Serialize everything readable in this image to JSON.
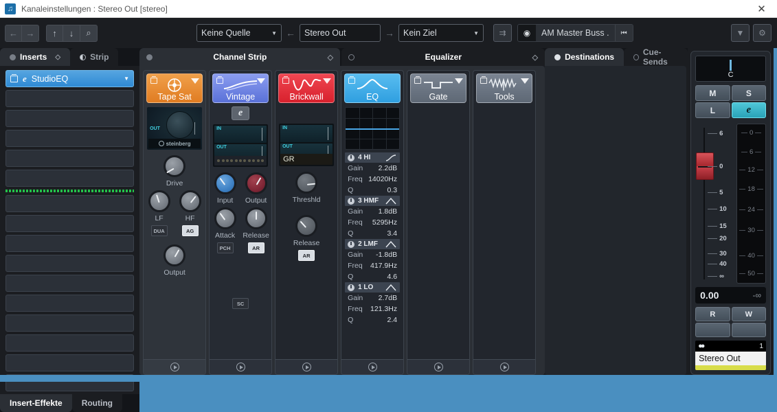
{
  "window": {
    "title": "Kanaleinstellungen : Stereo Out [stereo]",
    "close_label": "✕",
    "app_icon": "cubase-icon"
  },
  "toolbar": {
    "nav_back": "←",
    "nav_forward": "→",
    "up": "↑",
    "down": "↓",
    "search": "⌕",
    "source": {
      "value": "Keine Quelle",
      "arrow": "▼"
    },
    "arrow_left": "←",
    "channel": {
      "value": "Stereo Out"
    },
    "arrow_right": "→",
    "destination": {
      "value": "Kein Ziel",
      "arrow": "▼"
    },
    "bypass_icon": "output-routing-icon",
    "preset": {
      "icon": "preset-icon",
      "name": "AM Master Buss .",
      "prev": "⏮"
    },
    "menu_arrow": "▼",
    "settings_icon": "⚙"
  },
  "inserts": {
    "tabs": [
      {
        "label": "Inserts",
        "active": true,
        "dot": "filled"
      },
      {
        "label": "Strip",
        "active": false,
        "dot": "half"
      }
    ],
    "slots": [
      {
        "name": "StudioEQ",
        "active": true,
        "arrow": "▼",
        "edit": "e"
      },
      {
        "name": "",
        "active": false
      },
      {
        "name": "",
        "active": false
      },
      {
        "name": "",
        "active": false
      },
      {
        "name": "",
        "active": false
      },
      {
        "name": "",
        "active": false
      },
      {
        "name": "",
        "active": false
      },
      {
        "name": "",
        "active": false
      },
      {
        "name": "",
        "active": false
      },
      {
        "name": "",
        "active": false
      },
      {
        "name": "",
        "active": false
      },
      {
        "name": "",
        "active": false
      },
      {
        "name": "",
        "active": false
      },
      {
        "name": "",
        "active": false
      },
      {
        "name": "",
        "active": false
      },
      {
        "name": "",
        "active": false
      }
    ],
    "post_separator_after_slot": 6,
    "bottom_tabs": [
      {
        "label": "Insert-Effekte",
        "active": true
      },
      {
        "label": "Routing",
        "active": false
      }
    ]
  },
  "channel_strip": {
    "tab_label": "Channel Strip",
    "tab_active": true,
    "modules": [
      {
        "name": "Tape Sat",
        "color": "#e8892e",
        "icon": "tape-saturation-icon",
        "display": "tape",
        "display_label": "OUT",
        "brand": "steinberg",
        "knobs": [
          {
            "label": "Drive",
            "style": "grey",
            "angle": -120
          },
          {
            "label": "LF",
            "style": "grey",
            "angle": -18
          },
          {
            "label": "HF",
            "style": "grey",
            "angle": 38
          },
          {
            "label": "Output",
            "style": "grey",
            "angle": 30
          }
        ],
        "buttons": [
          {
            "label": "DUA",
            "on": false
          },
          {
            "label": "AG",
            "on": true
          }
        ],
        "foot_icon": "play-icon"
      },
      {
        "name": "Vintage",
        "color": "#6f84e0",
        "icon": "vintage-compressor-icon",
        "has_edit_button": true,
        "edit_label": "e",
        "display": "meters",
        "meter_labels": [
          "IN",
          "OUT"
        ],
        "knobs": [
          {
            "label": "Input",
            "style": "blue",
            "angle": -36
          },
          {
            "label": "Output",
            "style": "red",
            "angle": 30
          },
          {
            "label": "Attack",
            "style": "grey",
            "angle": -36
          },
          {
            "label": "Release",
            "style": "grey",
            "angle": 0
          }
        ],
        "buttons": [
          {
            "label": "PCH",
            "on": false
          },
          {
            "label": "AR",
            "on": true
          }
        ],
        "sidechain": "SC",
        "foot_icon": "play-icon"
      },
      {
        "name": "Brickwall",
        "color": "#e2323c",
        "icon": "brickwall-limiter-icon",
        "display": "meters",
        "meter_labels": [
          "IN",
          "OUT"
        ],
        "gr_label": "GR",
        "knobs": [
          {
            "label": "Threshld",
            "style": "dark",
            "angle": 84
          },
          {
            "label": "Release",
            "style": "dark",
            "angle": -42
          }
        ],
        "buttons": [
          {
            "label": "AR",
            "on": true
          }
        ],
        "foot_icon": "play-icon"
      }
    ]
  },
  "equalizer": {
    "tab_label": "Equalizer",
    "tab_active": false,
    "graph_flat": true,
    "bands": [
      {
        "name": "4 HI",
        "shape": "highshelf",
        "params": [
          {
            "label": "Gain",
            "value": "2.2dB"
          },
          {
            "label": "Freq",
            "value": "14020Hz"
          },
          {
            "label": "Q",
            "value": "0.3"
          }
        ]
      },
      {
        "name": "3 HMF",
        "shape": "peak",
        "params": [
          {
            "label": "Gain",
            "value": "1.8dB"
          },
          {
            "label": "Freq",
            "value": "5295Hz"
          },
          {
            "label": "Q",
            "value": "3.4"
          }
        ]
      },
      {
        "name": "2 LMF",
        "shape": "peak",
        "params": [
          {
            "label": "Gain",
            "value": "-1.8dB"
          },
          {
            "label": "Freq",
            "value": "417.9Hz"
          },
          {
            "label": "Q",
            "value": "4.6"
          }
        ]
      },
      {
        "name": "1 LO",
        "shape": "peak",
        "params": [
          {
            "label": "Gain",
            "value": "2.7dB"
          },
          {
            "label": "Freq",
            "value": "121.3Hz"
          },
          {
            "label": "Q",
            "value": "2.4"
          }
        ]
      }
    ],
    "modules": [
      {
        "name": "Gate",
        "color": "#6d7684",
        "icon": "gate-icon",
        "foot_icon": "play-icon"
      },
      {
        "name": "Tools",
        "color": "#6d7684",
        "icon": "tools-icon",
        "foot_icon": "play-icon"
      }
    ]
  },
  "destinations": {
    "tabs": [
      {
        "label": "Destinations",
        "active": true
      },
      {
        "label": "Cue-Sends",
        "active": false
      }
    ]
  },
  "fader_strip": {
    "pan": {
      "value": "C"
    },
    "buttons": [
      {
        "label": "M",
        "name": "mute-button",
        "style": "normal"
      },
      {
        "label": "S",
        "name": "solo-button",
        "style": "normal"
      },
      {
        "label": "L",
        "name": "listen-button",
        "style": "normal"
      },
      {
        "label": "e",
        "name": "edit-button",
        "style": "teal"
      }
    ],
    "fader_scale": [
      "6",
      "0",
      "5",
      "10",
      "15",
      "20",
      "30",
      "40",
      "∞"
    ],
    "meter_scale": [
      "0",
      "6",
      "12",
      "18",
      "24",
      "30",
      "40",
      "50"
    ],
    "gain_value": "0.00",
    "peak_value": "-∞",
    "automation": [
      {
        "label": "R",
        "name": "read-automation-button"
      },
      {
        "label": "W",
        "name": "write-automation-button"
      }
    ],
    "channel_name": "Stereo Out",
    "channel_number": "1",
    "channel_color": "#d8dd4a",
    "stereo_icon": "○○"
  }
}
